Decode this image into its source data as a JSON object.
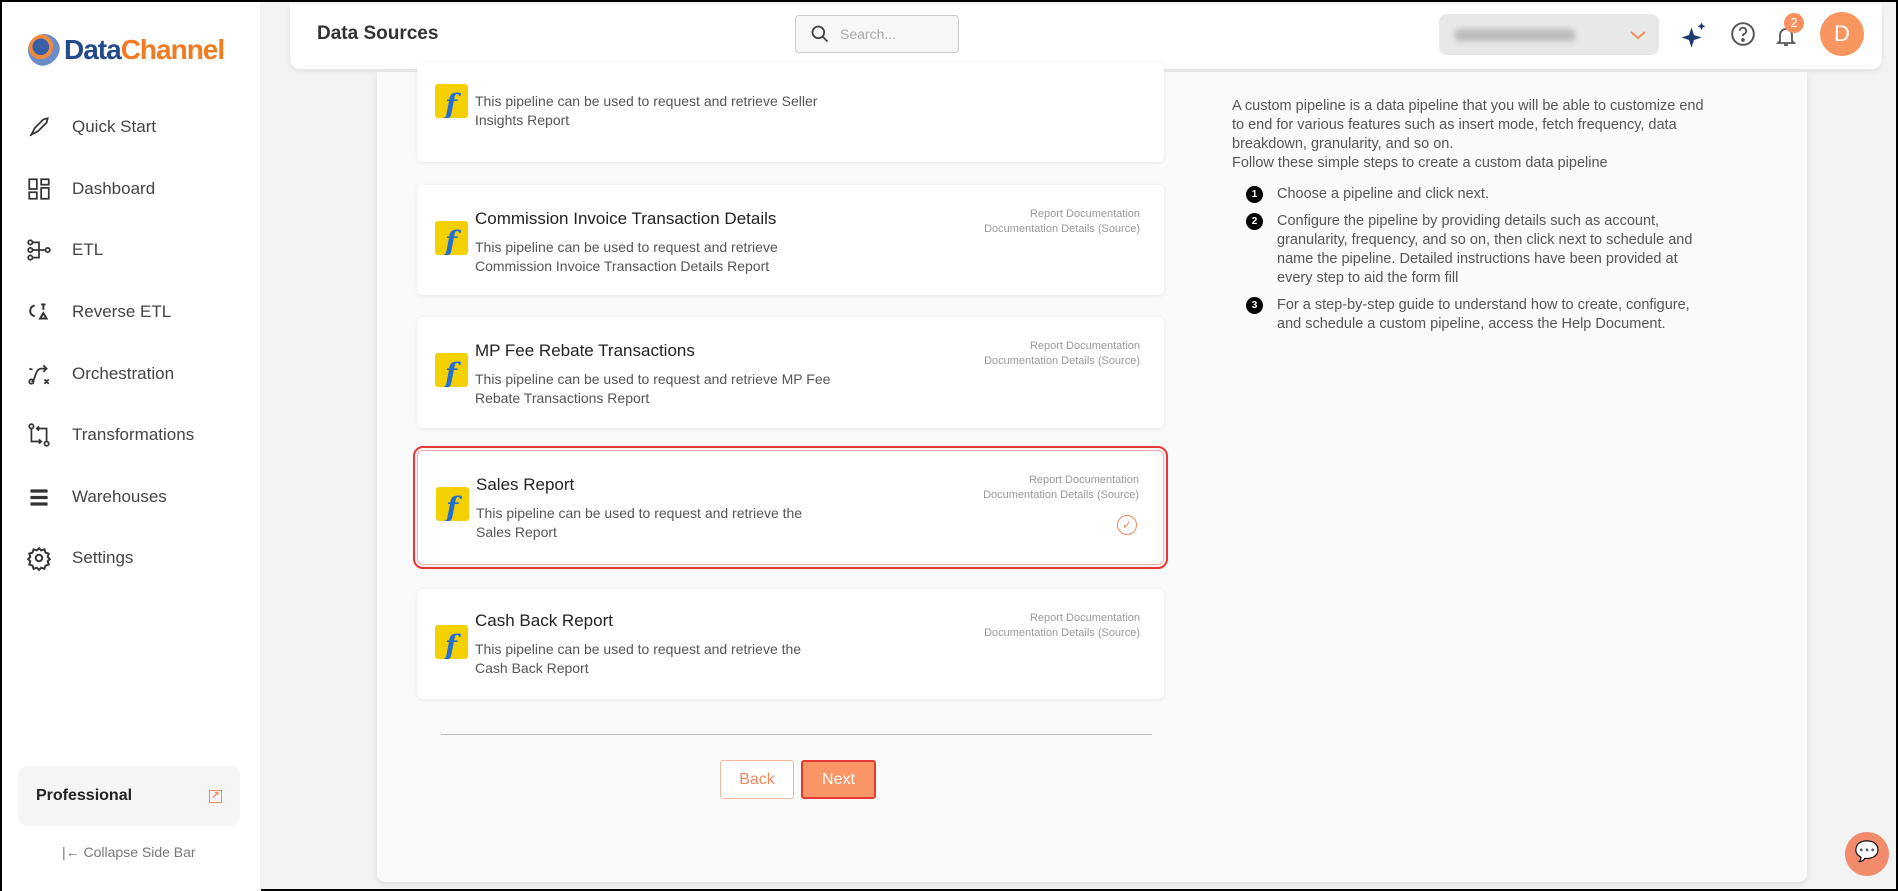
{
  "brand": {
    "part1": "Data",
    "part2": "Channel"
  },
  "sidebar": {
    "items": [
      {
        "label": "Quick Start",
        "icon": "rocket-icon"
      },
      {
        "label": "Dashboard",
        "icon": "dashboard-icon"
      },
      {
        "label": "ETL",
        "icon": "etl-icon"
      },
      {
        "label": "Reverse ETL",
        "icon": "reverse-etl-icon"
      },
      {
        "label": "Orchestration",
        "icon": "orchestration-icon"
      },
      {
        "label": "Transformations",
        "icon": "transformations-icon"
      },
      {
        "label": "Warehouses",
        "icon": "warehouses-icon"
      },
      {
        "label": "Settings",
        "icon": "gear-icon"
      }
    ],
    "plan": "Professional",
    "collapse": "Collapse Side Bar"
  },
  "header": {
    "title": "Data Sources",
    "search_placeholder": "Search...",
    "notifications": "2",
    "avatar": "D"
  },
  "cards": [
    {
      "title": "",
      "desc": "This pipeline can be used to request and retrieve Seller Insights Report",
      "links": [
        "",
        ""
      ]
    },
    {
      "title": "Commission Invoice Transaction Details",
      "desc": "This pipeline can be used to request and retrieve Commission Invoice Transaction Details Report",
      "links": [
        "Report Documentation",
        "Documentation Details (Source)"
      ]
    },
    {
      "title": "MP Fee Rebate Transactions",
      "desc": "This pipeline can be used to request and retrieve MP Fee Rebate Transactions Report",
      "links": [
        "Report Documentation",
        "Documentation Details (Source)"
      ]
    },
    {
      "title": "Sales Report",
      "desc": "This pipeline can be used to request and retrieve the Sales Report",
      "links": [
        "Report Documentation",
        "Documentation Details (Source)"
      ],
      "selected": true
    },
    {
      "title": "Cash Back Report",
      "desc": "This pipeline can be used to request and retrieve the Cash Back Report",
      "links": [
        "Report Documentation",
        "Documentation Details (Source)"
      ]
    }
  ],
  "buttons": {
    "back": "Back",
    "next": "Next"
  },
  "info": {
    "intro": "A custom pipeline is a data pipeline that you will be able to customize end to end for various features such as insert mode, fetch frequency, data breakdown, granularity, and so on.",
    "follow": "Follow these simple steps to create a custom data pipeline",
    "steps": [
      {
        "num": "1",
        "text": "Choose a pipeline and click next."
      },
      {
        "num": "2",
        "text": "Configure the pipeline by providing details such as account, granularity, frequency, and so on, then click next to schedule and name the pipeline. Detailed instructions have been provided at every step to aid the form fill"
      },
      {
        "num": "3",
        "text": "For a step-by-step guide to understand how to create, configure, and schedule a custom pipeline, access the Help Document."
      }
    ]
  },
  "colors": {
    "accent": "#fa9566",
    "selected_outline": "#e53935",
    "brand_blue": "#244a8c",
    "brand_orange": "#f07b22"
  }
}
